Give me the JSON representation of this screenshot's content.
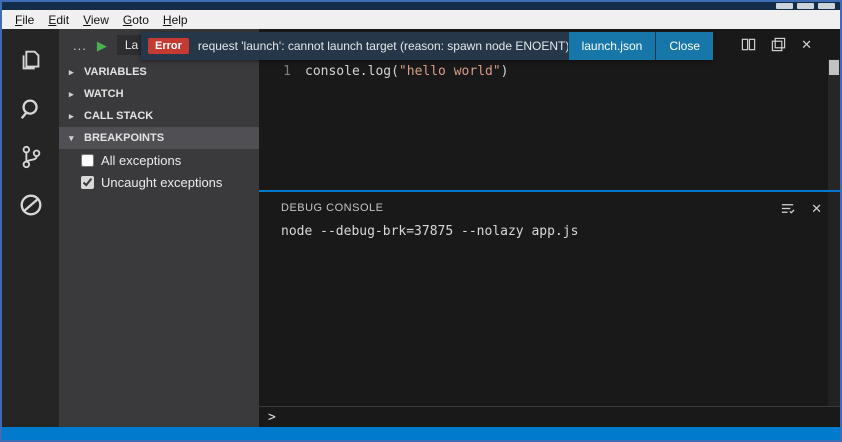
{
  "menu": {
    "items": [
      "File",
      "Edit",
      "View",
      "Goto",
      "Help"
    ]
  },
  "icons": {
    "play": "▶",
    "collapsed": "▸",
    "expanded": "▾",
    "close": "✕"
  },
  "activity_bar": {
    "icons": [
      "files-icon",
      "search-icon",
      "git-icon",
      "debug-icon"
    ]
  },
  "sidebar": {
    "toolbar": {
      "more": "...",
      "config": "La"
    },
    "sections": [
      {
        "label": "VARIABLES",
        "expanded": false
      },
      {
        "label": "WATCH",
        "expanded": false
      },
      {
        "label": "CALL STACK",
        "expanded": false
      },
      {
        "label": "BREAKPOINTS",
        "expanded": true
      }
    ],
    "breakpoints": [
      {
        "label": "All exceptions",
        "checked": false
      },
      {
        "label": "Uncaught exceptions",
        "checked": true
      }
    ]
  },
  "notification": {
    "severity_label": "Error",
    "message": "request 'launch': cannot launch target (reason: spawn node ENOENT)",
    "actions": [
      "launch.json",
      "Close"
    ]
  },
  "editor": {
    "line_number": "1",
    "tokens": {
      "head": "console.log(",
      "string": "\"hello world\"",
      "tail": ")"
    }
  },
  "panel": {
    "title": "DEBUG CONSOLE",
    "output": "node --debug-brk=37875 --nolazy app.js",
    "prompt": ">"
  },
  "colors": {
    "accent": "#007acc",
    "error_badge": "#c43b33",
    "notification_button": "#1677a8"
  }
}
